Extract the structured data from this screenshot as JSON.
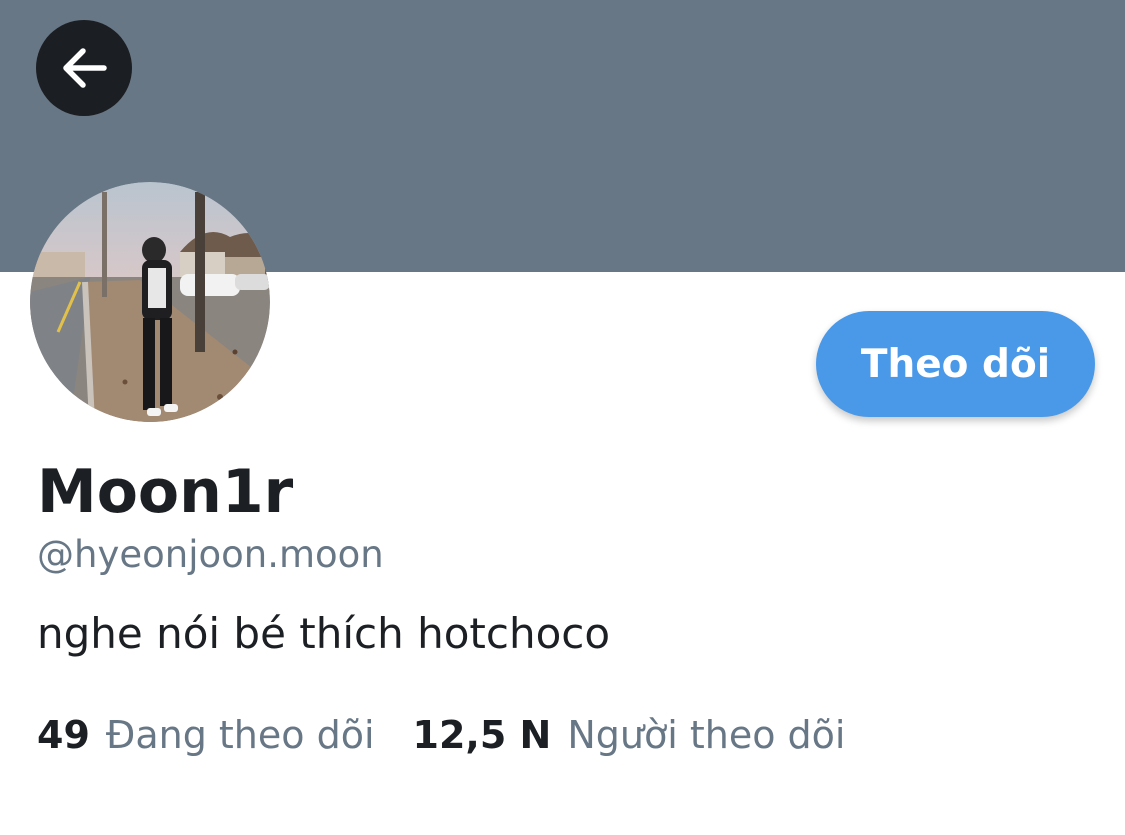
{
  "header": {
    "back_icon": "arrow-left-icon",
    "banner_color": "#687786"
  },
  "profile": {
    "avatar_description": "profile photo",
    "display_name": "Moon1r",
    "handle": "@hyeonjoon.moon",
    "bio": "nghe nói bé thích hotchoco"
  },
  "actions": {
    "follow_label": "Theo dõi",
    "follow_color": "#4a99e9"
  },
  "stats": {
    "following_count": "49",
    "following_label": "Đang theo dõi",
    "followers_count": "12,5 N",
    "followers_label": "Người theo dõi"
  }
}
